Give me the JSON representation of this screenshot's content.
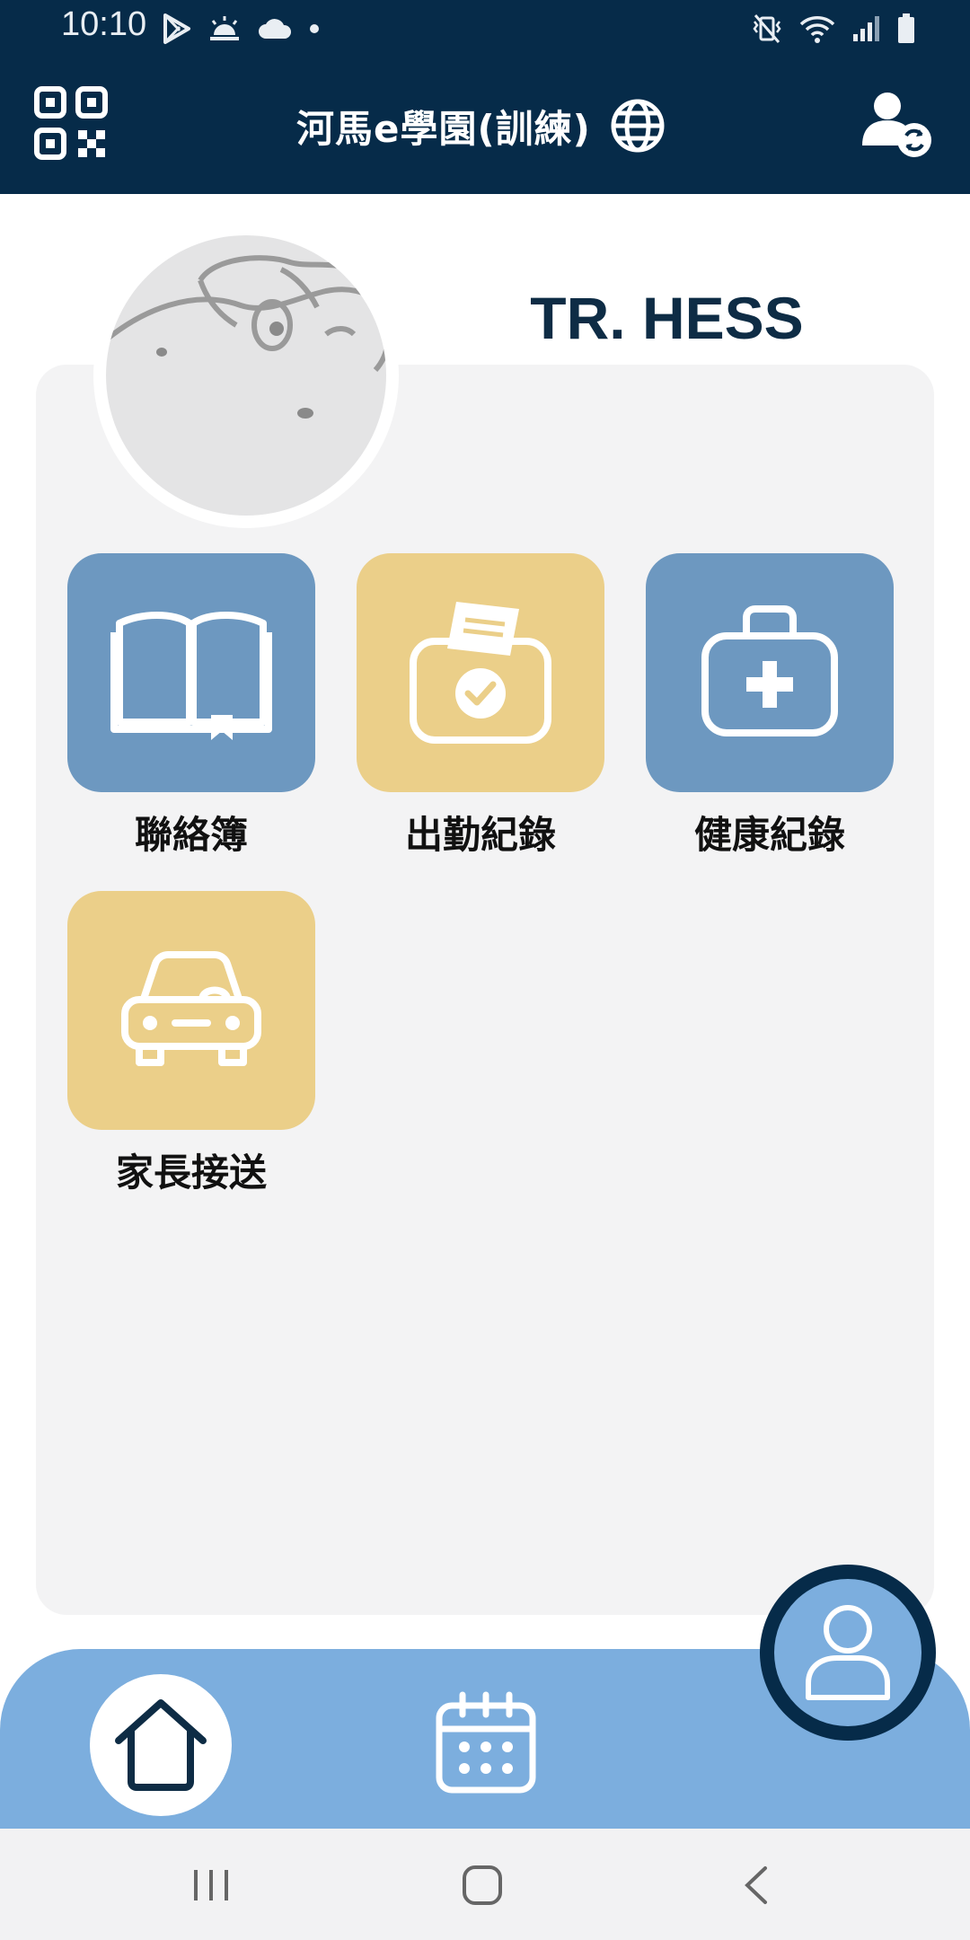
{
  "status_bar": {
    "time": "10:10",
    "left_icons": [
      "play-store-icon",
      "sunrise-icon",
      "cloud-icon",
      "dot-icon"
    ],
    "right_icons": [
      "vibrate-mute-icon",
      "wifi-icon",
      "signal-icon",
      "battery-icon"
    ]
  },
  "header": {
    "title": "河馬e學園(訓練)",
    "icons": [
      "qr-code-icon",
      "globe-icon",
      "user-switch-icon"
    ]
  },
  "profile": {
    "name": "TR. HESS"
  },
  "menu": {
    "tiles": [
      {
        "label": "聯絡簿",
        "icon": "book-icon",
        "color": "#6d98c0"
      },
      {
        "label": "出勤紀錄",
        "icon": "attendance-box-icon",
        "color": "#ebcf89"
      },
      {
        "label": "健康紀錄",
        "icon": "medical-kit-icon",
        "color": "#6d98c0"
      },
      {
        "label": "家長接送",
        "icon": "car-icon",
        "color": "#ebcf89"
      }
    ]
  },
  "bottom_nav": {
    "items": [
      "home-icon",
      "calendar-icon",
      "profile-icon"
    ],
    "active": "home-icon"
  },
  "colors": {
    "header_bg": "#062b49",
    "accent_blue": "#6d98c0",
    "accent_gold": "#ebcf89",
    "nav_bg": "#7caede"
  }
}
